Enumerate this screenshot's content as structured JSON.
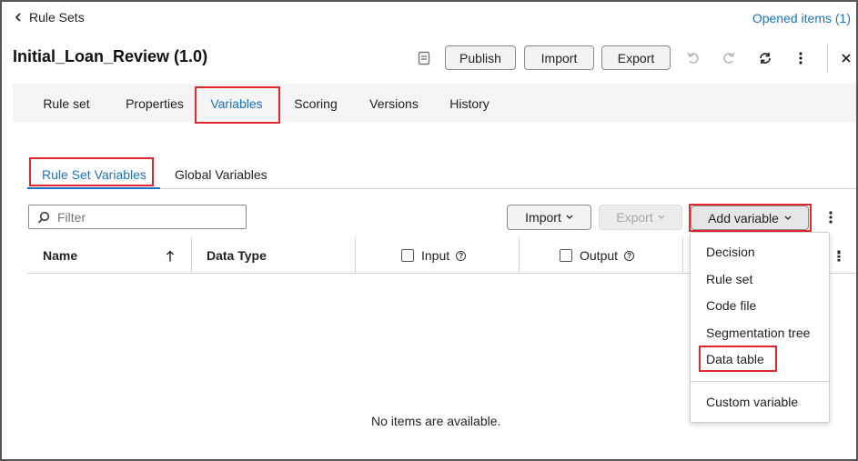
{
  "header": {
    "back_label": "Rule Sets",
    "opened_items": "Opened items (1)",
    "title": "Initial_Loan_Review (1.0)",
    "publish": "Publish",
    "import": "Import",
    "export": "Export"
  },
  "tabs": [
    "Rule set",
    "Properties",
    "Variables",
    "Scoring",
    "Versions",
    "History"
  ],
  "active_tab": "Variables",
  "subtabs": [
    "Rule Set Variables",
    "Global Variables"
  ],
  "active_subtab": "Rule Set Variables",
  "toolbar": {
    "filter_placeholder": "Filter",
    "import": "Import",
    "export": "Export",
    "add_variable": "Add variable"
  },
  "columns": [
    "Name",
    "Data Type",
    "Input",
    "Output"
  ],
  "empty_message": "No items are available.",
  "add_variable_menu": [
    "Decision",
    "Rule set",
    "Code file",
    "Segmentation tree",
    "Data table",
    "Custom variable"
  ],
  "colors": {
    "accent": "#1a73c0",
    "highlight": "#e0282e",
    "disabled": "#b8b8b8"
  }
}
